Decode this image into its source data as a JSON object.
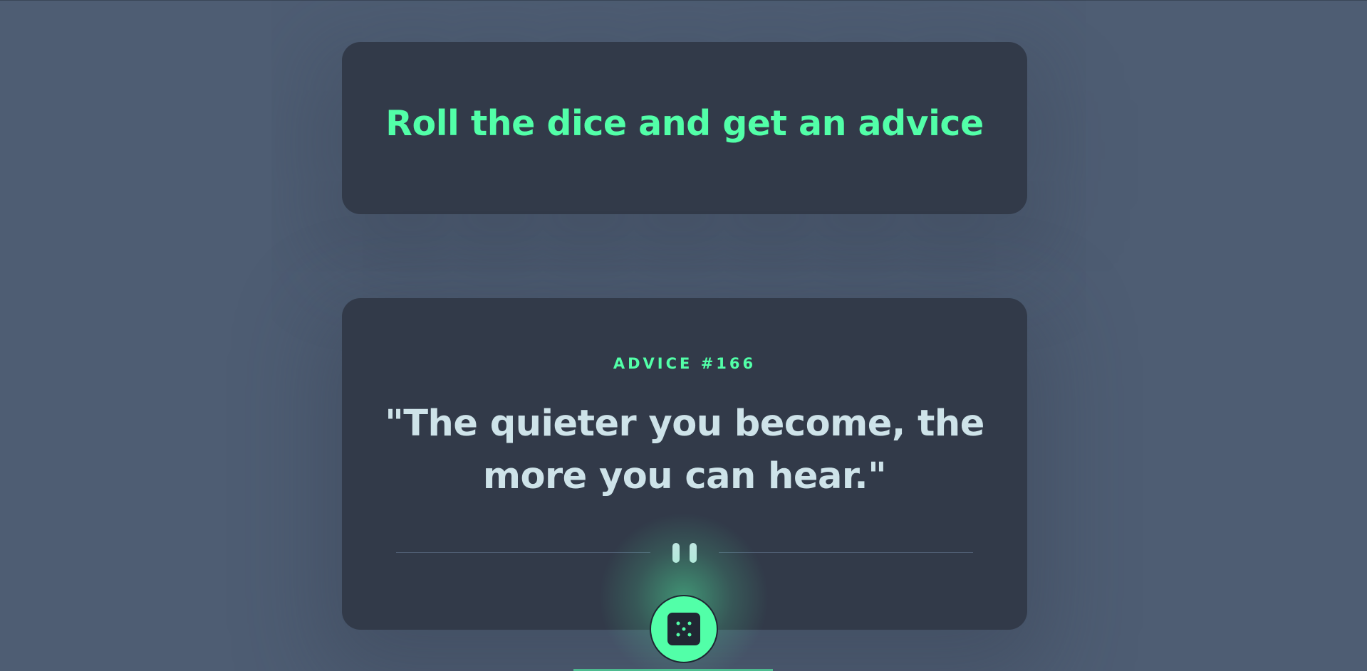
{
  "header": {
    "title": "Roll the dice and get an advice"
  },
  "advice": {
    "id_label": "ADVICE #166",
    "text": "\"The quieter you become, the more you can hear.\""
  },
  "controls": {
    "dice_icon": "dice-five-icon",
    "pause_icon": "pause-icon"
  },
  "colors": {
    "background": "#4e5d73",
    "card": "#323a49",
    "accent": "#52ffa8",
    "text": "#cee3e9"
  }
}
